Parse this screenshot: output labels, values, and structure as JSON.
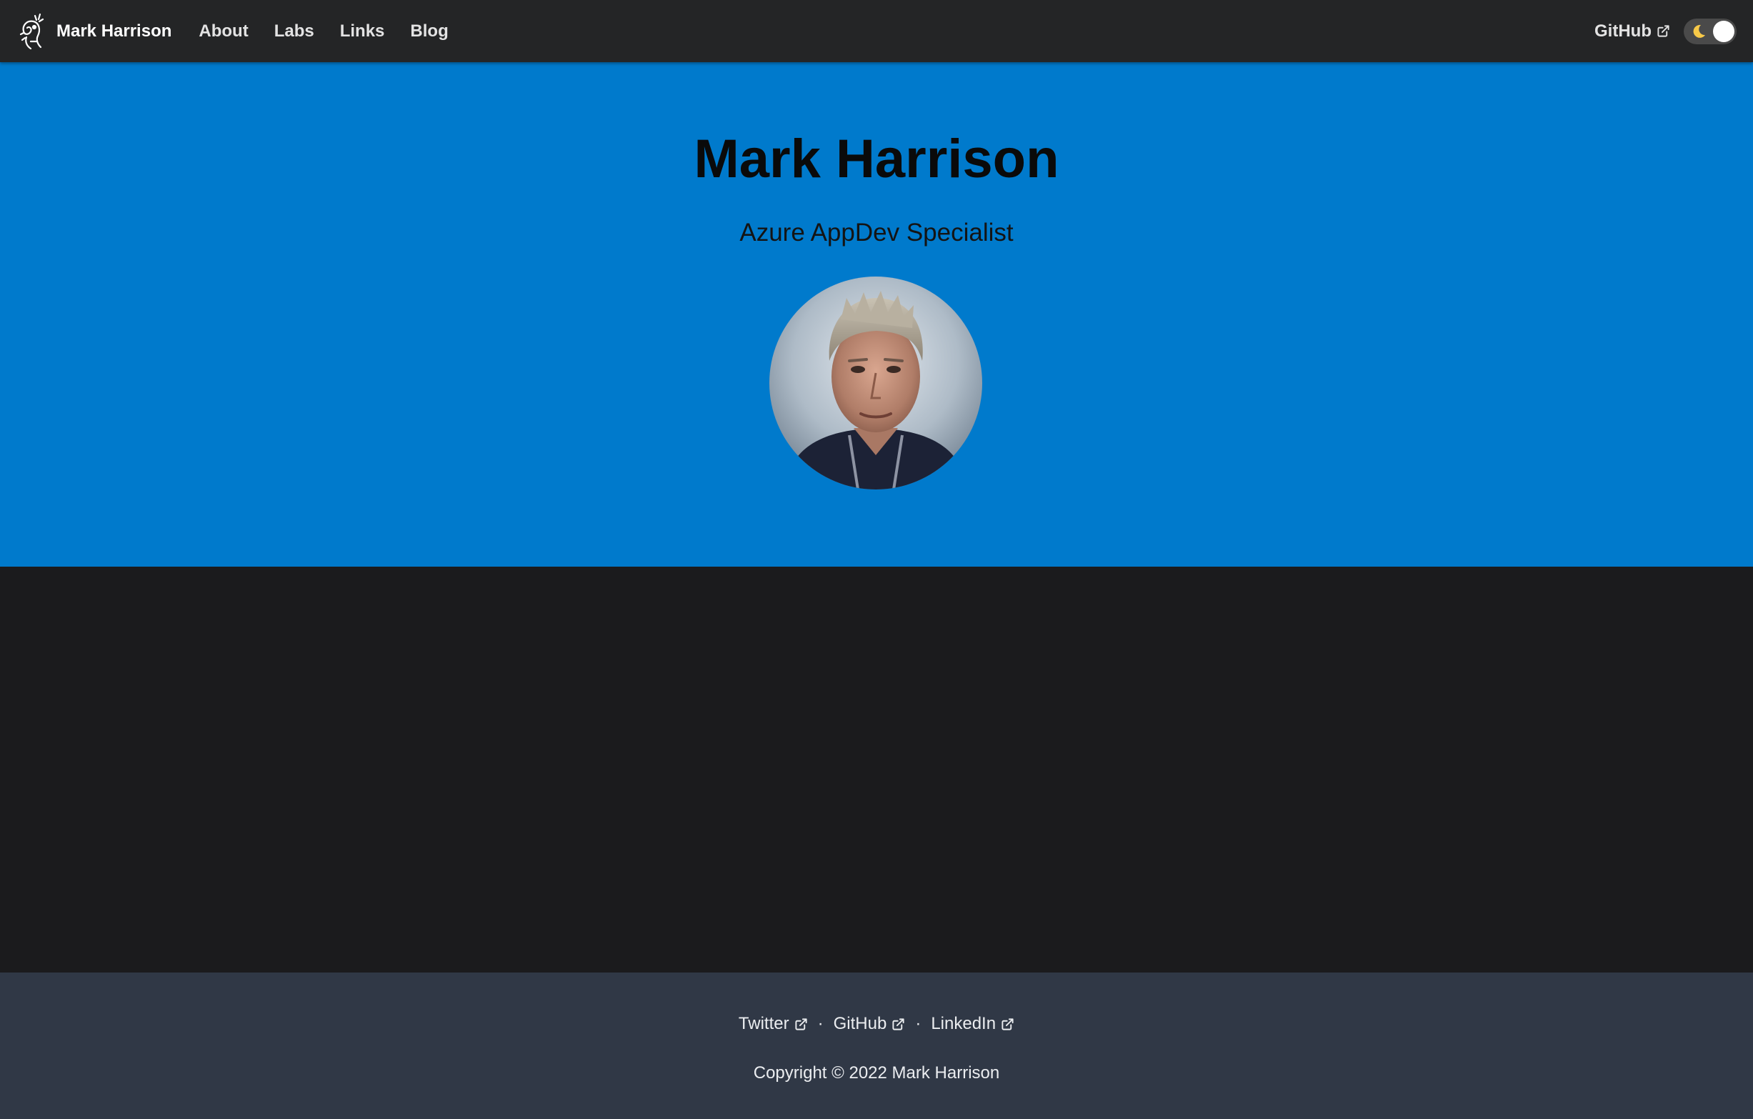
{
  "navbar": {
    "brand_title": "Mark Harrison",
    "items": [
      {
        "label": "About"
      },
      {
        "label": "Labs"
      },
      {
        "label": "Links"
      },
      {
        "label": "Blog"
      }
    ],
    "github_label": "GitHub",
    "theme_toggle": {
      "state": "dark",
      "icon": "moon-icon"
    }
  },
  "hero": {
    "title": "Mark Harrison",
    "subtitle": "Azure AppDev Specialist",
    "background_color": "#007acc"
  },
  "footer": {
    "links": [
      {
        "label": "Twitter"
      },
      {
        "label": "GitHub"
      },
      {
        "label": "LinkedIn"
      }
    ],
    "separator": "·",
    "copyright": "Copyright © 2022 Mark Harrison"
  },
  "colors": {
    "navbar_bg": "#242526",
    "page_bg": "#1b1b1d",
    "footer_bg": "#303846",
    "accent": "#007acc"
  }
}
